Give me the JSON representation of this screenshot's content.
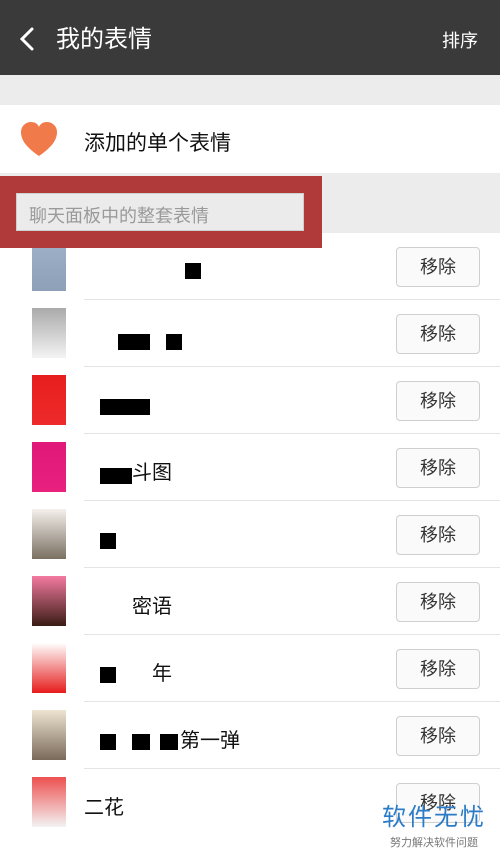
{
  "header": {
    "title": "我的表情",
    "sort_label": "排序"
  },
  "single": {
    "label": "添加的单个表情"
  },
  "section": {
    "label": "聊天面板中的整套表情"
  },
  "rows": [
    {
      "name": "",
      "action": "移除"
    },
    {
      "name": "",
      "action": "移除"
    },
    {
      "name": "",
      "action": "移除"
    },
    {
      "name": "斗图",
      "action": "移除"
    },
    {
      "name": "",
      "action": "移除"
    },
    {
      "name": "密语",
      "action": "移除"
    },
    {
      "name": "年",
      "action": "移除"
    },
    {
      "name": "第一弹",
      "action": "移除"
    },
    {
      "name": "二花",
      "action": "移除"
    }
  ],
  "watermark": {
    "title": "软件无忧",
    "subtitle": "努力解决软件问题"
  },
  "colors": {
    "topbar": "#3a3a3a",
    "highlight": "#b03a3a",
    "heart": "#f07a4a",
    "watermark": "#2b7bc8"
  },
  "icons": {
    "back": "chevron-left-icon",
    "single": "heart-icon"
  }
}
